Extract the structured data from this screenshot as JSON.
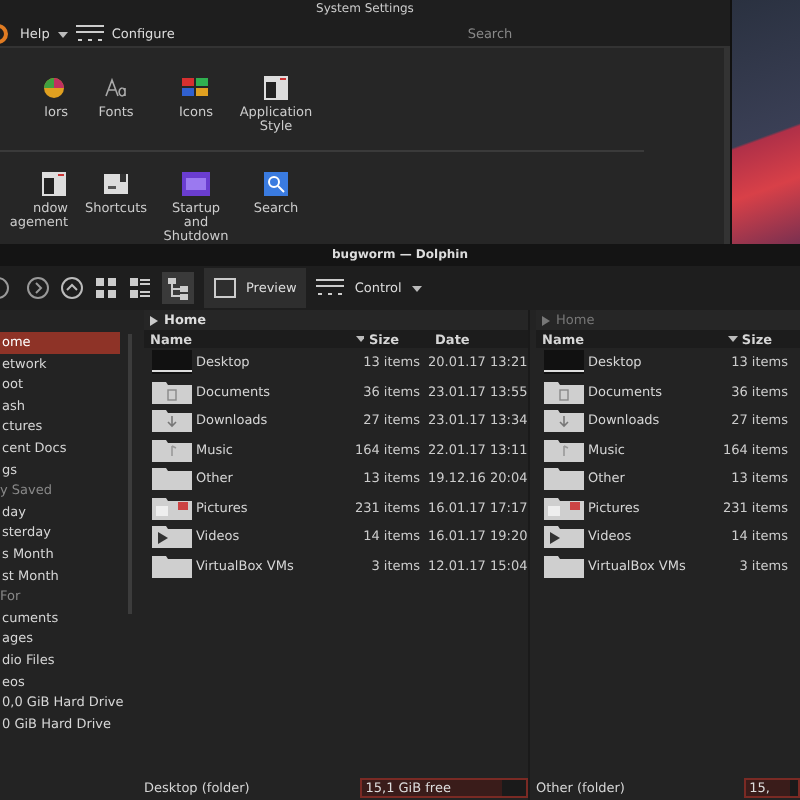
{
  "settings": {
    "title": "System Settings",
    "toolbar": {
      "help": "Help",
      "configure": "Configure",
      "search": {
        "placeholder": "Search"
      }
    },
    "modules": [
      [
        {
          "label": "lors",
          "kind": "colors"
        },
        {
          "label": "Fonts",
          "kind": "fonts"
        },
        {
          "label": "Icons",
          "kind": "icons"
        },
        {
          "label": "Application Style",
          "kind": "style"
        }
      ],
      [
        {
          "label": "ndow agement",
          "kind": "window"
        },
        {
          "label": "Shortcuts",
          "kind": "shortcuts"
        },
        {
          "label": "Startup and Shutdown",
          "kind": "startup"
        },
        {
          "label": "Search",
          "kind": "search"
        }
      ]
    ]
  },
  "dolphin": {
    "title": "bugworm — Dolphin",
    "toolbar": {
      "preview": "Preview",
      "control": "Control"
    },
    "sidebar": [
      {
        "label": "ome",
        "kind": "item",
        "selected": true
      },
      {
        "label": "etwork",
        "kind": "item",
        "selected": false
      },
      {
        "label": "oot",
        "kind": "item",
        "selected": false
      },
      {
        "label": "ash",
        "kind": "item",
        "selected": false
      },
      {
        "label": "ctures",
        "kind": "item",
        "selected": false
      },
      {
        "label": "cent Docs",
        "kind": "item",
        "selected": false
      },
      {
        "label": "gs",
        "kind": "item",
        "selected": false
      },
      {
        "label": "y Saved",
        "kind": "header"
      },
      {
        "label": "day",
        "kind": "item",
        "selected": false
      },
      {
        "label": "sterday",
        "kind": "item",
        "selected": false
      },
      {
        "label": "s Month",
        "kind": "item",
        "selected": false
      },
      {
        "label": "st Month",
        "kind": "item",
        "selected": false
      },
      {
        "label": "For",
        "kind": "header"
      },
      {
        "label": "cuments",
        "kind": "item",
        "selected": false
      },
      {
        "label": "ages",
        "kind": "item",
        "selected": false
      },
      {
        "label": "dio Files",
        "kind": "item",
        "selected": false
      },
      {
        "label": "eos",
        "kind": "item",
        "selected": false
      },
      {
        "label": "0,0 GiB Hard Drive",
        "kind": "item",
        "selected": false
      },
      {
        "label": "0 GiB Hard Drive",
        "kind": "item",
        "selected": false
      }
    ],
    "panes": [
      {
        "active": true,
        "breadcrumb": "Home",
        "columns": [
          "Name",
          "Size",
          "Date"
        ],
        "rows": [
          {
            "kind": "desktop",
            "name": "Desktop",
            "size": "13 items",
            "date": "20.01.17 13:21"
          },
          {
            "kind": "documents",
            "name": "Documents",
            "size": "36 items",
            "date": "23.01.17 13:55"
          },
          {
            "kind": "downloads",
            "name": "Downloads",
            "size": "27 items",
            "date": "23.01.17 13:34"
          },
          {
            "kind": "music",
            "name": "Music",
            "size": "164 items",
            "date": "22.01.17 13:11"
          },
          {
            "kind": "folder",
            "name": "Other",
            "size": "13 items",
            "date": "19.12.16 20:04"
          },
          {
            "kind": "pictures",
            "name": "Pictures",
            "size": "231 items",
            "date": "16.01.17 17:17"
          },
          {
            "kind": "videos",
            "name": "Videos",
            "size": "14 items",
            "date": "16.01.17 19:20"
          },
          {
            "kind": "folder",
            "name": "VirtualBox VMs",
            "size": "3 items",
            "date": "12.01.17 15:04"
          }
        ],
        "status": "Desktop (folder)",
        "free": "15,1 GiB free",
        "level": 0.85
      },
      {
        "active": false,
        "breadcrumb": "Home",
        "columns": [
          "Name",
          "Size"
        ],
        "rows": [
          {
            "kind": "desktop",
            "name": "Desktop",
            "size": "13 items"
          },
          {
            "kind": "documents",
            "name": "Documents",
            "size": "36 items"
          },
          {
            "kind": "downloads",
            "name": "Downloads",
            "size": "27 items"
          },
          {
            "kind": "music",
            "name": "Music",
            "size": "164 items"
          },
          {
            "kind": "folder",
            "name": "Other",
            "size": "13 items"
          },
          {
            "kind": "pictures",
            "name": "Pictures",
            "size": "231 items"
          },
          {
            "kind": "videos",
            "name": "Videos",
            "size": "14 items"
          },
          {
            "kind": "folder",
            "name": "VirtualBox VMs",
            "size": "3 items"
          }
        ],
        "status": "Other (folder)",
        "free": "15,",
        "level": 0.85
      }
    ]
  }
}
